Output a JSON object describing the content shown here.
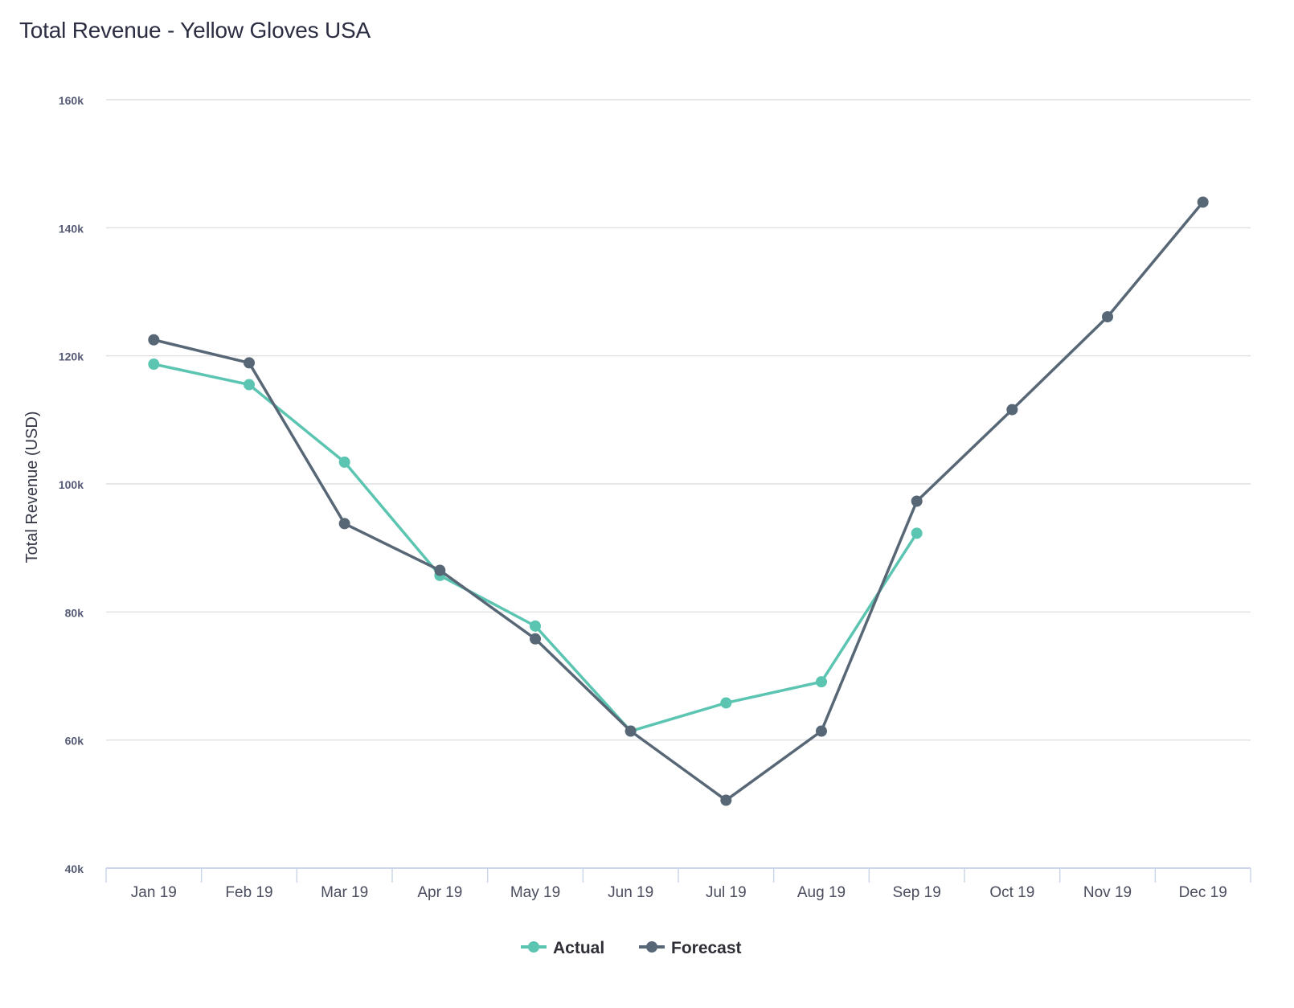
{
  "chart_data": {
    "type": "line",
    "title": "Total Revenue - Yellow Gloves USA",
    "xlabel": "",
    "ylabel": "Total Revenue (USD)",
    "categories": [
      "Jan 19",
      "Feb 19",
      "Mar 19",
      "Apr 19",
      "May 19",
      "Jun 19",
      "Jul 19",
      "Aug 19",
      "Sep 19",
      "Oct 19",
      "Nov 19",
      "Dec 19"
    ],
    "ylim": [
      40000,
      160000
    ],
    "yticks": [
      40000,
      60000,
      80000,
      100000,
      120000,
      140000,
      160000
    ],
    "ytick_labels": [
      "40k",
      "60k",
      "80k",
      "100k",
      "120k",
      "140k",
      "160k"
    ],
    "grid": true,
    "legend_position": "bottom-center",
    "series": [
      {
        "name": "Actual",
        "color": "#5bc5b2",
        "values": [
          118700,
          115500,
          103400,
          85700,
          77800,
          61400,
          65800,
          69100,
          92300,
          null,
          null,
          null
        ]
      },
      {
        "name": "Forecast",
        "color": "#586776",
        "values": [
          122500,
          118900,
          93800,
          86500,
          75800,
          61400,
          50600,
          61400,
          97300,
          111600,
          126100,
          144000
        ]
      }
    ]
  }
}
